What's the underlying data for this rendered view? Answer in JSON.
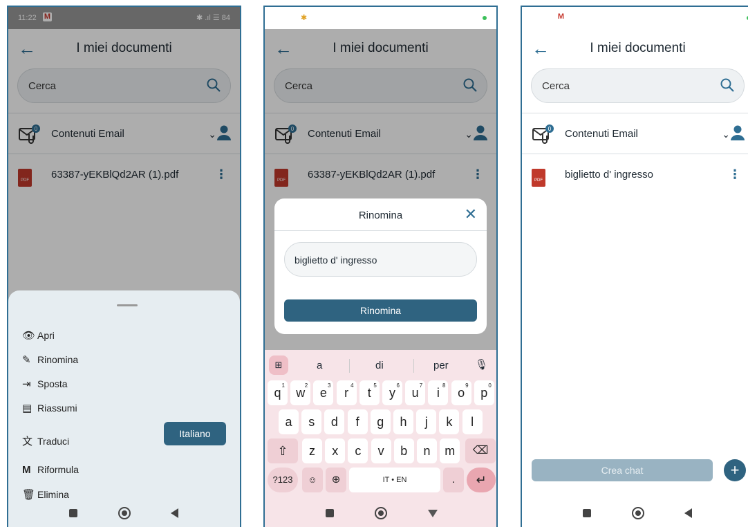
{
  "status": {
    "time": "11:22",
    "gmail_glyph": "M",
    "right_icons": "✱ .ıl ☰ 84"
  },
  "app": {
    "title": "I miei documenti",
    "search_placeholder": "Cerca"
  },
  "email_section": {
    "label": "Contenuti Email",
    "badge": "0"
  },
  "files": {
    "original": "63387-yEKBlQd2AR (1).pdf",
    "renamed": "biglietto d' ingresso",
    "pdf_tag": "PDF"
  },
  "menu": {
    "items": [
      {
        "icon": "👁",
        "label": "Apri"
      },
      {
        "icon": "✎",
        "label": "Rinomina"
      },
      {
        "icon": "⇥",
        "label": "Sposta"
      },
      {
        "icon": "▤",
        "label": "Riassumi"
      },
      {
        "icon": "文",
        "label": "Traduci"
      },
      {
        "icon": "M",
        "label": "Riformula"
      },
      {
        "icon": "🗑",
        "label": "Elimina"
      }
    ],
    "language_button": "Italiano"
  },
  "dialog": {
    "title": "Rinomina",
    "input_value": "biglietto d' ingresso",
    "confirm": "Rinomina"
  },
  "keyboard": {
    "suggestions": [
      "a",
      "di",
      "per"
    ],
    "row1": [
      "q",
      "w",
      "e",
      "r",
      "t",
      "y",
      "u",
      "i",
      "o",
      "p"
    ],
    "row1_nums": [
      "1",
      "2",
      "3",
      "4",
      "5",
      "6",
      "7",
      "8",
      "9",
      "0"
    ],
    "row2": [
      "a",
      "s",
      "d",
      "f",
      "g",
      "h",
      "j",
      "k",
      "l"
    ],
    "row3": [
      "z",
      "x",
      "c",
      "v",
      "b",
      "n",
      "m"
    ],
    "mode_key": "?123",
    "space_label": "IT • EN",
    "period": "."
  },
  "bottom": {
    "create_chat": "Crea chat"
  },
  "colors": {
    "accent": "#2f6e93",
    "button": "#2f6380",
    "sheet": "#e6edf1",
    "keyboard": "#f7e4e8"
  }
}
